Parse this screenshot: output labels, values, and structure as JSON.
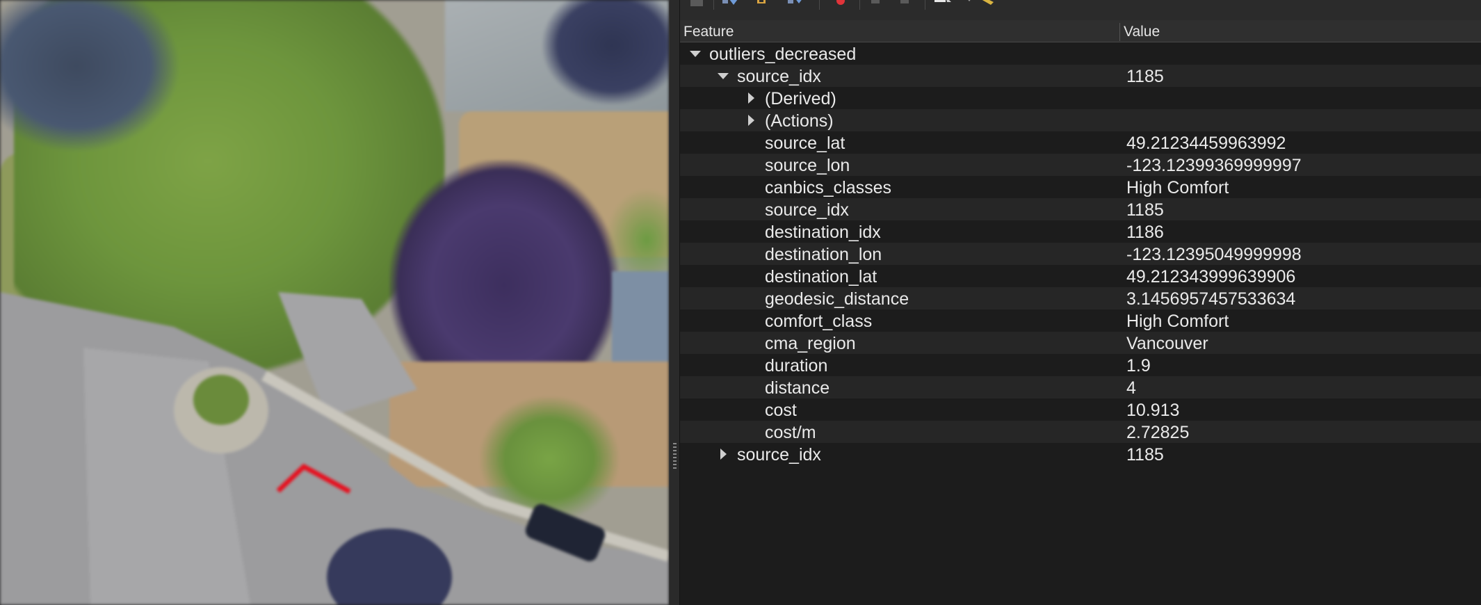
{
  "map": {
    "route_color": "#e0101e"
  },
  "toolbar": {
    "buttons": [
      {
        "name": "expand-icon"
      },
      {
        "name": "collapse-icon"
      },
      {
        "name": "expand-new-icon"
      },
      {
        "name": "deselect-icon"
      },
      {
        "name": "copy-icon"
      },
      {
        "name": "print-icon"
      },
      {
        "name": "select-identify-icon"
      },
      {
        "name": "measure-icon"
      }
    ]
  },
  "table": {
    "columns": [
      "Feature",
      "Value"
    ],
    "rows": [
      {
        "feature": "outliers_decreased",
        "value": "",
        "indent": 0,
        "toggle": "expanded"
      },
      {
        "feature": "source_idx",
        "value": "1185",
        "indent": 1,
        "toggle": "expanded"
      },
      {
        "feature": "(Derived)",
        "value": "",
        "indent": 2,
        "toggle": "collapsed"
      },
      {
        "feature": "(Actions)",
        "value": "",
        "indent": 2,
        "toggle": "collapsed"
      },
      {
        "feature": "source_lat",
        "value": "49.21234459963992",
        "indent": 2,
        "toggle": "none"
      },
      {
        "feature": "source_lon",
        "value": "-123.12399369999997",
        "indent": 2,
        "toggle": "none"
      },
      {
        "feature": "canbics_classes",
        "value": "High Comfort",
        "indent": 2,
        "toggle": "none"
      },
      {
        "feature": "source_idx",
        "value": "1185",
        "indent": 2,
        "toggle": "none"
      },
      {
        "feature": "destination_idx",
        "value": "1186",
        "indent": 2,
        "toggle": "none"
      },
      {
        "feature": "destination_lon",
        "value": "-123.12395049999998",
        "indent": 2,
        "toggle": "none"
      },
      {
        "feature": "destination_lat",
        "value": "49.212343999639906",
        "indent": 2,
        "toggle": "none"
      },
      {
        "feature": "geodesic_distance",
        "value": "3.1456957457533634",
        "indent": 2,
        "toggle": "none"
      },
      {
        "feature": "comfort_class",
        "value": "High Comfort",
        "indent": 2,
        "toggle": "none"
      },
      {
        "feature": "cma_region",
        "value": "Vancouver",
        "indent": 2,
        "toggle": "none"
      },
      {
        "feature": "duration",
        "value": "1.9",
        "indent": 2,
        "toggle": "none"
      },
      {
        "feature": "distance",
        "value": "4",
        "indent": 2,
        "toggle": "none"
      },
      {
        "feature": "cost",
        "value": "10.913",
        "indent": 2,
        "toggle": "none"
      },
      {
        "feature": "cost/m",
        "value": "2.72825",
        "indent": 2,
        "toggle": "none"
      },
      {
        "feature": "source_idx",
        "value": "1185",
        "indent": 1,
        "toggle": "collapsed"
      }
    ]
  }
}
